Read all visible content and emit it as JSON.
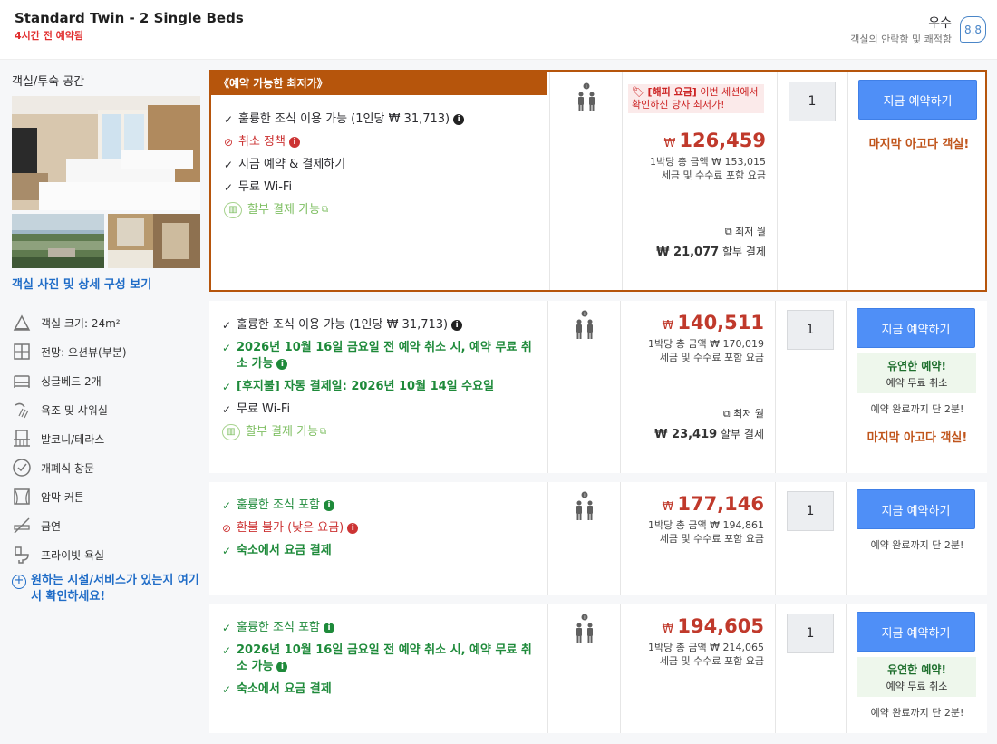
{
  "header": {
    "room_title": "Standard Twin - 2 Single Beds",
    "booked_recently": "4시간 전 예약됨",
    "rating_word": "우수",
    "rating_sub": "객실의 안락함 및 쾌적함",
    "rating_score": "8.8"
  },
  "left_panel": {
    "title": "객실/투숙 공간",
    "photos_link": "객실 사진 및 상세 구성 보기",
    "features": [
      {
        "label": "객실 크기: 24m²",
        "icon": "room-size-icon"
      },
      {
        "label": "전망: 오션뷰(부분)",
        "icon": "view-icon"
      },
      {
        "label": "싱글베드 2개",
        "icon": "bed-icon"
      },
      {
        "label": "욕조 및 샤워실",
        "icon": "shower-icon"
      },
      {
        "label": "발코니/테라스",
        "icon": "balcony-icon"
      },
      {
        "label": "개폐식 창문",
        "icon": "window-icon"
      },
      {
        "label": "암막 커튼",
        "icon": "curtain-icon"
      },
      {
        "label": "금연",
        "icon": "no-smoking-icon"
      },
      {
        "label": "프라이빗 욕실",
        "icon": "toilet-icon"
      }
    ],
    "facility_link": "원하는 시설/서비스가 있는지 여기서 확인하세요!"
  },
  "offers": [
    {
      "deal_banner": "《예약 가능한 최저가》",
      "features": [
        {
          "text": "훌륭한 조식 이용 가능 (1인당 ₩ 31,713)",
          "style": "plain",
          "mark": "✓",
          "info": true
        },
        {
          "text": "취소 정책",
          "style": "red",
          "mark": "⊘",
          "info": true
        },
        {
          "text": "지금 예약 & 결제하기",
          "style": "plain",
          "mark": "✓",
          "info": false
        },
        {
          "text": "무료 Wi-Fi",
          "style": "plain",
          "mark": "✓",
          "info": false
        },
        {
          "text": "할부 결제 가능",
          "style": "install",
          "mark": "",
          "info": false
        }
      ],
      "happy_tag_bold": "[해피 요금]",
      "happy_tag_text": " 이번 세션에서 확인하신 당사 최저가!",
      "currency": "₩",
      "price": "126,459",
      "per_night": "1박당 총 금액 ₩ 153,015",
      "tax_note": "세금 및 수수료 포함 요금",
      "installment_min": "최저 월",
      "installment_amount": "₩ 21,077",
      "installment_suffix": "할부 결제",
      "quantity": "1",
      "book_label": "지금 예약하기",
      "last_chance": "마지막 아고다 객실!"
    },
    {
      "features": [
        {
          "text": "훌륭한 조식 이용 가능 (1인당 ₩ 31,713)",
          "style": "plain",
          "mark": "✓",
          "info": true
        },
        {
          "text": "2026년 10월 16일 금요일 전 예약 취소 시, 예약 무료 취소 가능",
          "style": "green",
          "mark": "✓",
          "info": true
        },
        {
          "text": "[후지불] 자동 결제일: 2026년 10월 14일 수요일",
          "style": "green",
          "mark": "✓",
          "info": false
        },
        {
          "text": "무료 Wi-Fi",
          "style": "plain",
          "mark": "✓",
          "info": false
        },
        {
          "text": "할부 결제 가능",
          "style": "install",
          "mark": "",
          "info": false
        }
      ],
      "currency": "₩",
      "price": "140,511",
      "per_night": "1박당 총 금액 ₩ 170,019",
      "tax_note": "세금 및 수수료 포함 요금",
      "installment_min": "최저 월",
      "installment_amount": "₩ 23,419",
      "installment_suffix": "할부 결제",
      "quantity": "1",
      "book_label": "지금 예약하기",
      "flex_title": "유연한 예약!",
      "flex_sub": "예약 무료 취소",
      "two_min": "예약 완료까지 단 2분!",
      "last_chance": "마지막 아고다 객실!"
    },
    {
      "features": [
        {
          "text": "훌륭한 조식 포함",
          "style": "greenlite",
          "mark": "✓",
          "info": true
        },
        {
          "text": "환불 불가 (낮은 요금)",
          "style": "red",
          "mark": "⊘",
          "info": true
        },
        {
          "text": "숙소에서 요금 결제",
          "style": "green",
          "mark": "✓",
          "info": false
        }
      ],
      "currency": "₩",
      "price": "177,146",
      "per_night": "1박당 총 금액 ₩ 194,861",
      "tax_note": "세금 및 수수료 포함 요금",
      "quantity": "1",
      "book_label": "지금 예약하기",
      "two_min": "예약 완료까지 단 2분!"
    },
    {
      "features": [
        {
          "text": "훌륭한 조식 포함",
          "style": "greenlite",
          "mark": "✓",
          "info": true
        },
        {
          "text": "2026년 10월 16일 금요일 전 예약 취소 시, 예약 무료 취소 가능",
          "style": "green",
          "mark": "✓",
          "info": true
        },
        {
          "text": "숙소에서 요금 결제",
          "style": "green",
          "mark": "✓",
          "info": false
        }
      ],
      "currency": "₩",
      "price": "194,605",
      "per_night": "1박당 총 금액 ₩ 214,065",
      "tax_note": "세금 및 수수료 포함 요금",
      "quantity": "1",
      "book_label": "지금 예약하기",
      "flex_title": "유연한 예약!",
      "flex_sub": "예약 무료 취소",
      "two_min": "예약 완료까지 단 2분!"
    }
  ]
}
